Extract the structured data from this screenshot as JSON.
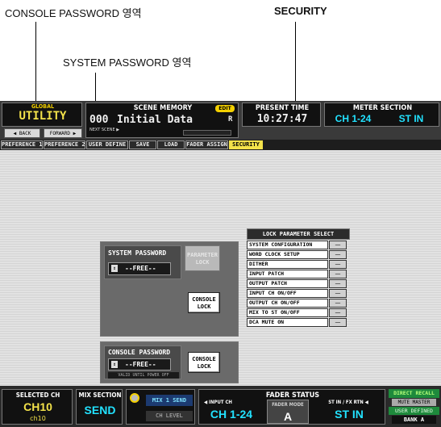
{
  "annotations": {
    "console_password_area": "CONSOLE PASSWORD 영역",
    "security": "SECURITY",
    "system_password_area": "SYSTEM PASSWORD 영역"
  },
  "topbar": {
    "global_label": "GLOBAL",
    "utility": "UTILITY",
    "back": "◀ BACK",
    "forward": "FORWARD ▶",
    "scene_memory_label": "SCENE MEMORY",
    "edit_badge": "EDIT",
    "scene_number": "000",
    "scene_title": "Initial Data",
    "scene_r": "R",
    "next_scene": "NEXT SCENE ▶",
    "present_time_label": "PRESENT TIME",
    "present_time": "10:27:47",
    "meter_section_label": "METER SECTION",
    "meter_ch": "CH 1-24",
    "meter_st": "ST IN"
  },
  "tabs": [
    "PREFERENCE 1",
    "PREFERENCE 2",
    "USER DEFINE",
    "SAVE",
    "LOAD",
    "FADER ASSIGN",
    "SECURITY"
  ],
  "system_password": {
    "title": "SYSTEM PASSWORD",
    "value": "--FREE--",
    "param_lock_line1": "PARAMETER",
    "param_lock_line2": "LOCK",
    "console_lock_line1": "CONSOLE",
    "console_lock_line2": "LOCK"
  },
  "console_password": {
    "title": "CONSOLE PASSWORD",
    "value": "--FREE--",
    "valid_note": "VALID UNTIL POWER OFF",
    "console_lock_line1": "CONSOLE",
    "console_lock_line2": "LOCK"
  },
  "lock_parameter": {
    "header": "LOCK PARAMETER SELECT",
    "items": [
      {
        "label": "SYSTEM CONFIGURATION",
        "toggle": "—"
      },
      {
        "label": "WORD CLOCK SETUP",
        "toggle": "—"
      },
      {
        "label": "DITHER",
        "toggle": "—"
      },
      {
        "label": "INPUT PATCH",
        "toggle": "—"
      },
      {
        "label": "OUTPUT PATCH",
        "toggle": "—"
      },
      {
        "label": "INPUT CH ON/OFF",
        "toggle": "—"
      },
      {
        "label": "OUTPUT CH ON/OFF",
        "toggle": "—"
      },
      {
        "label": "MIX TO ST ON/OFF",
        "toggle": "—"
      },
      {
        "label": "DCA MUTE ON",
        "toggle": "—"
      }
    ]
  },
  "bottombar": {
    "selected_ch_label": "SELECTED CH",
    "selected_ch": "CH10",
    "selected_ch_sub": "ch10",
    "mix_section_label": "MIX SECTION",
    "mix_send": "SEND",
    "mix1_send": "MIX 1 SEND",
    "ch_level": "CH LEVEL",
    "fader_status_label": "FADER STATUS",
    "input_ch_label": "◀ INPUT CH",
    "input_ch": "CH 1-24",
    "fader_mode_label": "FADER MODE",
    "fader_mode": "A",
    "st_in_label": "ST IN / FX RTN ◀",
    "st_in": "ST IN",
    "direct_recall": "DIRECT RECALL",
    "mute_master": "MUTE MASTER",
    "user_defined_keys": "USER DEFINED KEYS",
    "bank": "BANK A"
  }
}
